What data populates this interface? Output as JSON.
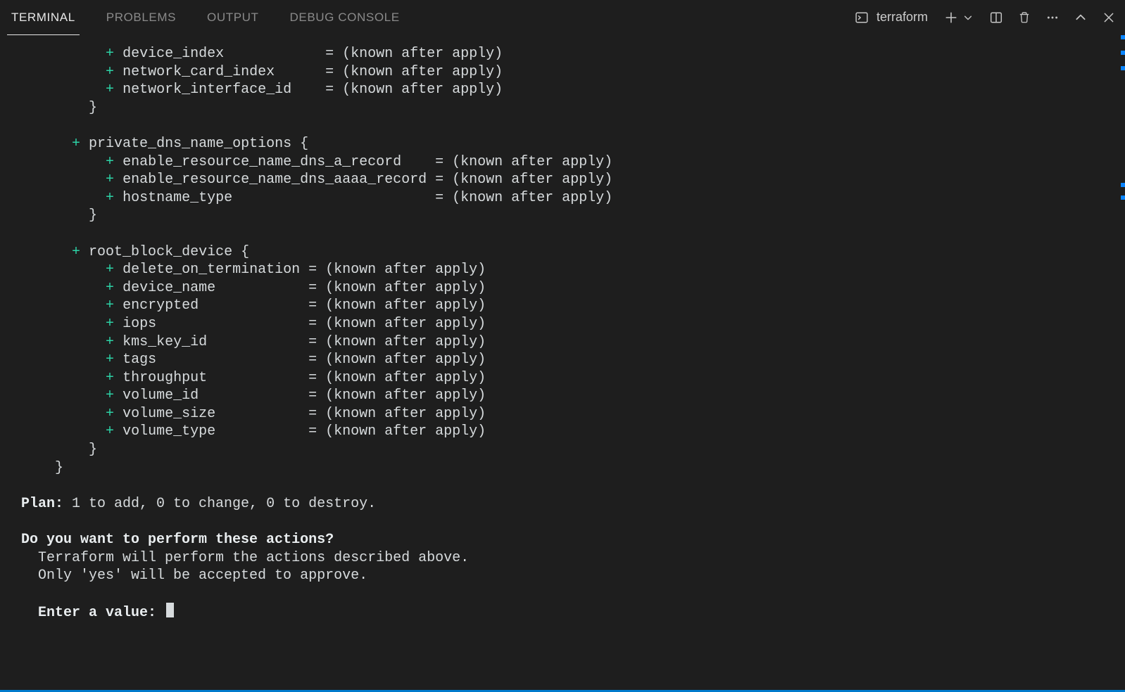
{
  "tabs": {
    "terminal": "TERMINAL",
    "problems": "PROBLEMS",
    "output": "OUTPUT",
    "debug_console": "DEBUG CONSOLE"
  },
  "terminal_label": "terraform",
  "plan": {
    "network_interface": {
      "attrs": [
        {
          "name": "device_index",
          "value": "(known after apply)"
        },
        {
          "name": "network_card_index",
          "value": "(known after apply)"
        },
        {
          "name": "network_interface_id",
          "value": "(known after apply)"
        }
      ],
      "pad": 23
    },
    "private_dns_name_options": {
      "title": "private_dns_name_options {",
      "attrs": [
        {
          "name": "enable_resource_name_dns_a_record",
          "value": "(known after apply)"
        },
        {
          "name": "enable_resource_name_dns_aaaa_record",
          "value": "(known after apply)"
        },
        {
          "name": "hostname_type",
          "value": "(known after apply)"
        }
      ],
      "pad": 36
    },
    "root_block_device": {
      "title": "root_block_device {",
      "attrs": [
        {
          "name": "delete_on_termination",
          "value": "(known after apply)"
        },
        {
          "name": "device_name",
          "value": "(known after apply)"
        },
        {
          "name": "encrypted",
          "value": "(known after apply)"
        },
        {
          "name": "iops",
          "value": "(known after apply)"
        },
        {
          "name": "kms_key_id",
          "value": "(known after apply)"
        },
        {
          "name": "tags",
          "value": "(known after apply)"
        },
        {
          "name": "throughput",
          "value": "(known after apply)"
        },
        {
          "name": "volume_id",
          "value": "(known after apply)"
        },
        {
          "name": "volume_size",
          "value": "(known after apply)"
        },
        {
          "name": "volume_type",
          "value": "(known after apply)"
        }
      ],
      "pad": 21
    }
  },
  "summary": {
    "label": "Plan:",
    "rest": " 1 to add, 0 to change, 0 to destroy."
  },
  "confirm": {
    "question": "Do you want to perform these actions?",
    "line1": "  Terraform will perform the actions described above.",
    "line2": "  Only 'yes' will be accepted to approve.",
    "prompt_label": "Enter a value:",
    "prompt_indent": "  "
  },
  "marks": [
    0,
    22,
    44,
    210,
    228
  ]
}
